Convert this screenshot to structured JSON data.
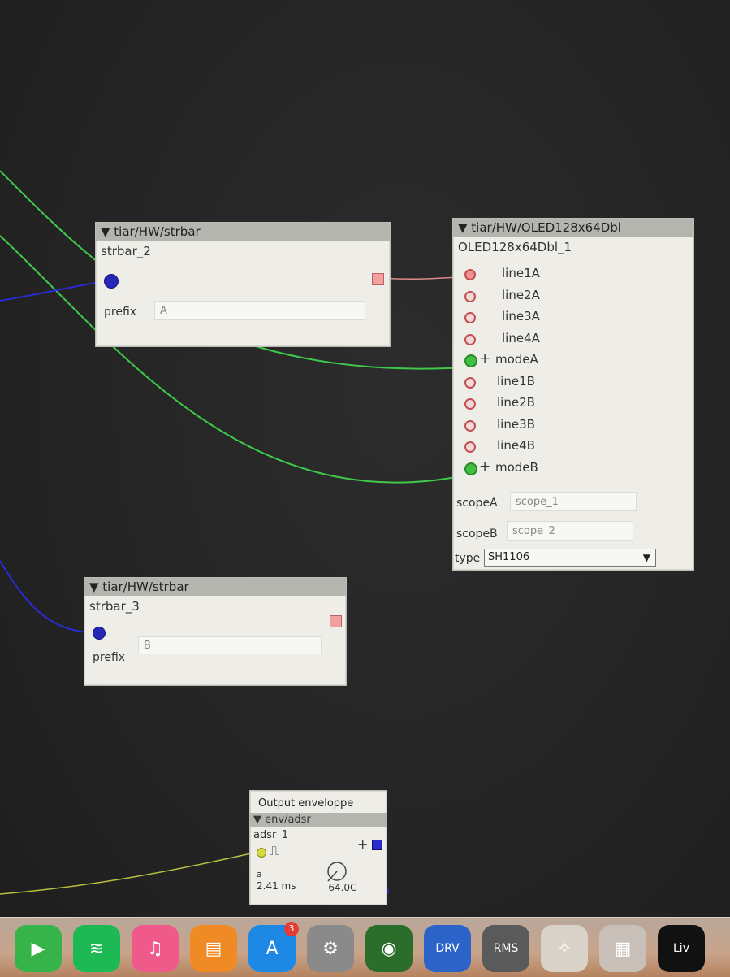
{
  "strbar_a": {
    "header": "▼ tiar/HW/strbar",
    "instance": "strbar_2",
    "prefix_label": "prefix",
    "prefix_value": "A"
  },
  "strbar_b": {
    "header": "▼ tiar/HW/strbar",
    "instance": "strbar_3",
    "prefix_label": "prefix",
    "prefix_value": "B"
  },
  "oled": {
    "header": "▼ tiar/HW/OLED128x64Dbl",
    "instance": "OLED128x64Dbl_1",
    "inlets": [
      {
        "name": "line1A",
        "kind": "string"
      },
      {
        "name": "line2A",
        "kind": "string"
      },
      {
        "name": "line3A",
        "kind": "string"
      },
      {
        "name": "line4A",
        "kind": "string"
      },
      {
        "name": "modeA",
        "kind": "bool"
      },
      {
        "name": "line1B",
        "kind": "string"
      },
      {
        "name": "line2B",
        "kind": "string"
      },
      {
        "name": "line3B",
        "kind": "string"
      },
      {
        "name": "line4B",
        "kind": "string"
      },
      {
        "name": "modeB",
        "kind": "bool"
      }
    ],
    "scopeA_label": "scopeA",
    "scopeA_value": "scope_1",
    "scopeB_label": "scopeB",
    "scopeB_value": "scope_2",
    "type_label": "type",
    "type_value": "SH1106",
    "inlet_plus": "+"
  },
  "env": {
    "title": "Output enveloppe",
    "header": "▼ env/adsr",
    "instance": "adsr_1",
    "gate_glyph": "⎍",
    "param_label": "a",
    "param_value": "2.41 ms",
    "knob_value": "-64.0C",
    "plus": "+"
  },
  "dock": {
    "items": [
      {
        "name": "facetime",
        "color": "#36b44a",
        "glyph": "▶"
      },
      {
        "name": "spotify",
        "color": "#1db954",
        "glyph": "≋"
      },
      {
        "name": "itunes",
        "color": "#f05a8a",
        "glyph": "♫"
      },
      {
        "name": "books",
        "color": "#f08a24",
        "glyph": "▤"
      },
      {
        "name": "app-store",
        "color": "#1e88e5",
        "glyph": "A",
        "badge": "3"
      },
      {
        "name": "system-preferences",
        "color": "#8a8a8a",
        "glyph": "⚙"
      },
      {
        "name": "traktor",
        "color": "#2b6e2b",
        "glyph": "◉"
      },
      {
        "name": "drv",
        "color": "#2c63c9",
        "glyph": "DRV"
      },
      {
        "name": "rms",
        "color": "#5a5a5a",
        "glyph": "RMS"
      },
      {
        "name": "bug-app",
        "color": "#d9d2c9",
        "glyph": "✧"
      },
      {
        "name": "panel-app",
        "color": "#c8c0b8",
        "glyph": "▦"
      },
      {
        "name": "live",
        "color": "#111111",
        "glyph": "Liv"
      }
    ]
  },
  "colors": {
    "wire_green": "#3ec94a",
    "wire_blue": "#2a2ad0",
    "wire_pink": "#d98a8a",
    "wire_yellow": "#b8c040"
  }
}
